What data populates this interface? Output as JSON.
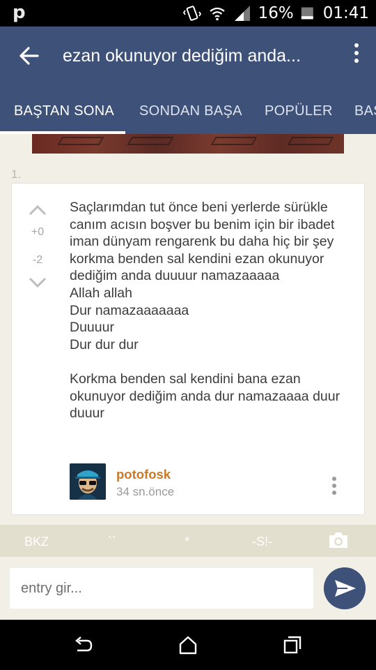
{
  "status_bar": {
    "notification_icon": "p",
    "icons": [
      "vibrate-icon",
      "wifi-icon",
      "signal-icon"
    ],
    "battery": "16%",
    "time": "01:41"
  },
  "app_bar": {
    "title": "ezan okunuyor dediğim anda...",
    "tabs": [
      {
        "label": "BAŞTAN SONA",
        "active": true
      },
      {
        "label": "SONDAN BAŞA",
        "active": false
      },
      {
        "label": "POPÜLER",
        "active": false
      },
      {
        "label": "BAŞ",
        "active": false
      }
    ]
  },
  "entry": {
    "index": "1.",
    "upvotes": "+0",
    "downvotes": "-2",
    "paragraphs": [
      "Saçlarımdan tut önce beni yerlerde sürükle canım acısın boşver bu benim için bir ibadet iman dünyam rengarenk bu daha hiç bir şey korkma benden sal kendini ezan okunuyor dediğim anda duuuur namazaaaaa\nAllah allah\nDur namazaaaaaaa\nDuuuur\nDur dur dur",
      "Korkma benden sal kendini bana ezan okunuyor dediğim anda dur namazaaaa duur duuur"
    ],
    "author": "potofosk",
    "time": "34 sn.önce"
  },
  "format_bar": {
    "bkz": "BKZ",
    "backtick": "``",
    "star": "*",
    "spoiler": "-S!-"
  },
  "composer": {
    "placeholder": "entry gir..."
  },
  "colors": {
    "primary": "#3e5179",
    "author": "#c77a2a",
    "background": "#f2f0e6",
    "format_bar": "#e3dfcf"
  }
}
